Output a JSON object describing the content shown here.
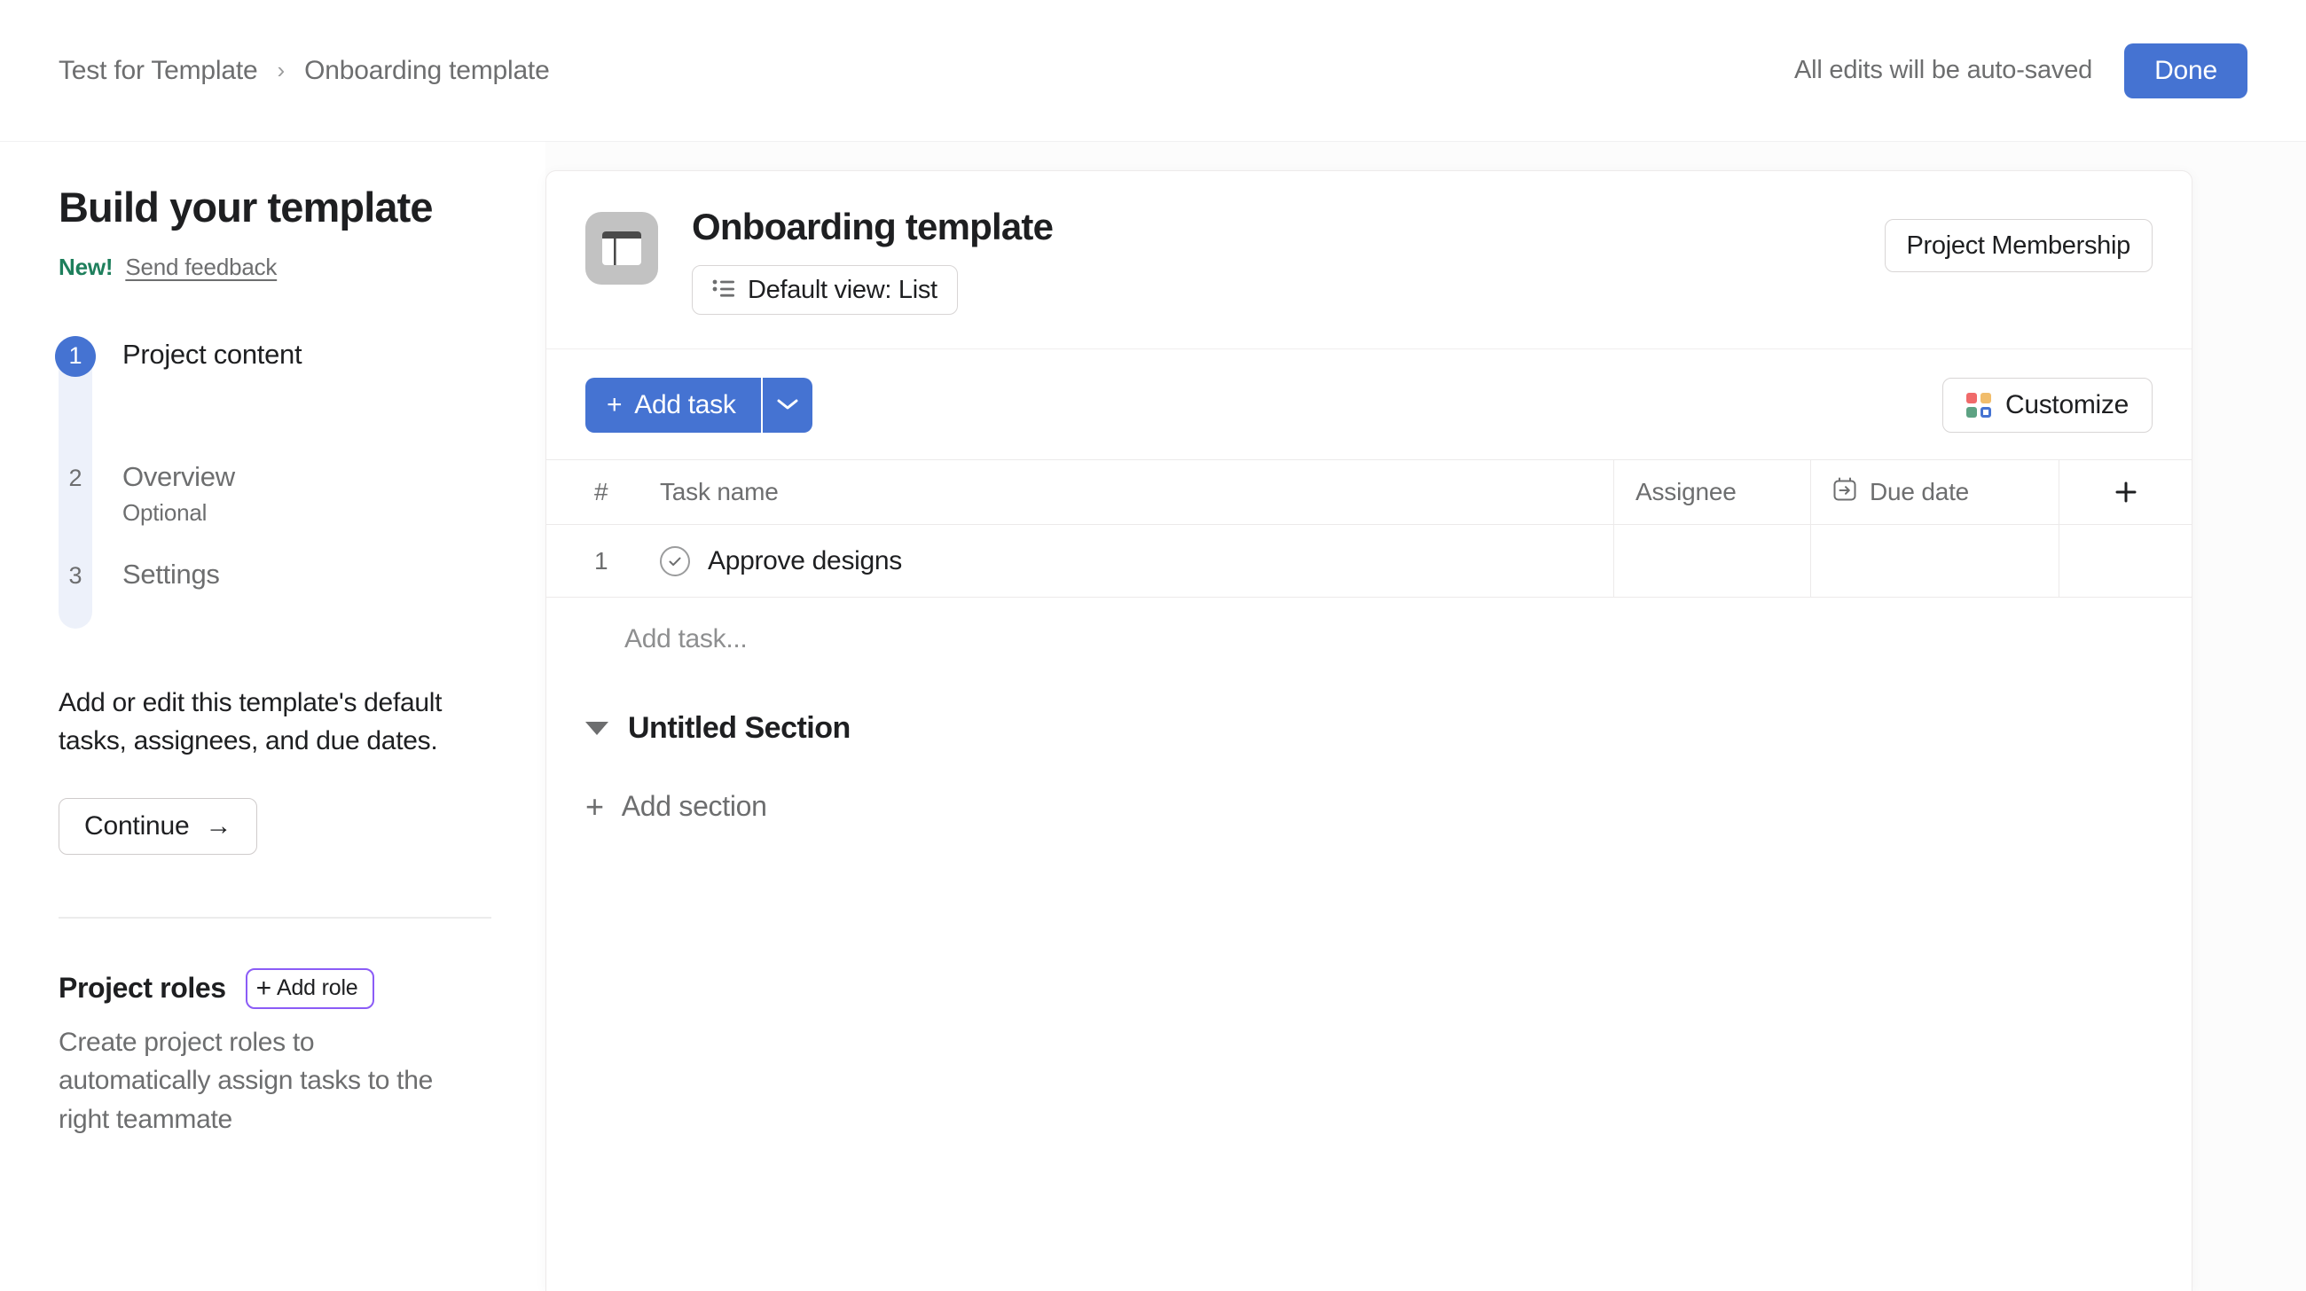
{
  "topbar": {
    "breadcrumb": [
      {
        "label": "Test for Template"
      },
      {
        "label": "Onboarding template"
      }
    ],
    "separator": "›",
    "autosave_text": "All edits will be auto-saved",
    "done_label": "Done"
  },
  "sidebar": {
    "title": "Build your template",
    "new_badge": "New!",
    "feedback_link": "Send feedback",
    "steps": [
      {
        "number": "1",
        "label": "Project content",
        "sub": "",
        "active": true
      },
      {
        "number": "2",
        "label": "Overview",
        "sub": "Optional",
        "active": false
      },
      {
        "number": "3",
        "label": "Settings",
        "sub": "",
        "active": false
      }
    ],
    "description": "Add or edit this template's default tasks, assignees, and due dates.",
    "continue_label": "Continue",
    "continue_arrow": "→",
    "roles": {
      "title": "Project roles",
      "add_role_label": "Add role",
      "add_role_plus": "+",
      "description": "Create project roles to automatically assign tasks to the right teammate"
    }
  },
  "project": {
    "icon_name": "project-board-icon",
    "title": "Onboarding template",
    "view_chip_label": "Default view: List",
    "membership_label": "Project Membership"
  },
  "toolbar": {
    "add_task_label": "Add task",
    "add_task_plus": "+",
    "customize_label": "Customize",
    "customize_colors": [
      "#f06a6a",
      "#f1bd6c",
      "#5da283",
      "#4573d2"
    ]
  },
  "table": {
    "columns": [
      {
        "key": "num",
        "label": "#"
      },
      {
        "key": "name",
        "label": "Task name"
      },
      {
        "key": "assignee",
        "label": "Assignee"
      },
      {
        "key": "due",
        "label": "Due date"
      },
      {
        "key": "add",
        "label": "+"
      }
    ],
    "rows": [
      {
        "num": "1",
        "name": "Approve designs",
        "assignee": "",
        "due": ""
      }
    ],
    "add_task_placeholder": "Add task...",
    "section_title": "Untitled Section",
    "add_section_label": "Add section",
    "add_section_plus": "+"
  },
  "colors": {
    "accent": "#4573d2",
    "purple_outline": "#8b5cf6",
    "green": "#1e7f5c",
    "text_primary": "#1e1f21",
    "text_secondary": "#6d6e6f",
    "stepper_track": "#edf1fa"
  }
}
